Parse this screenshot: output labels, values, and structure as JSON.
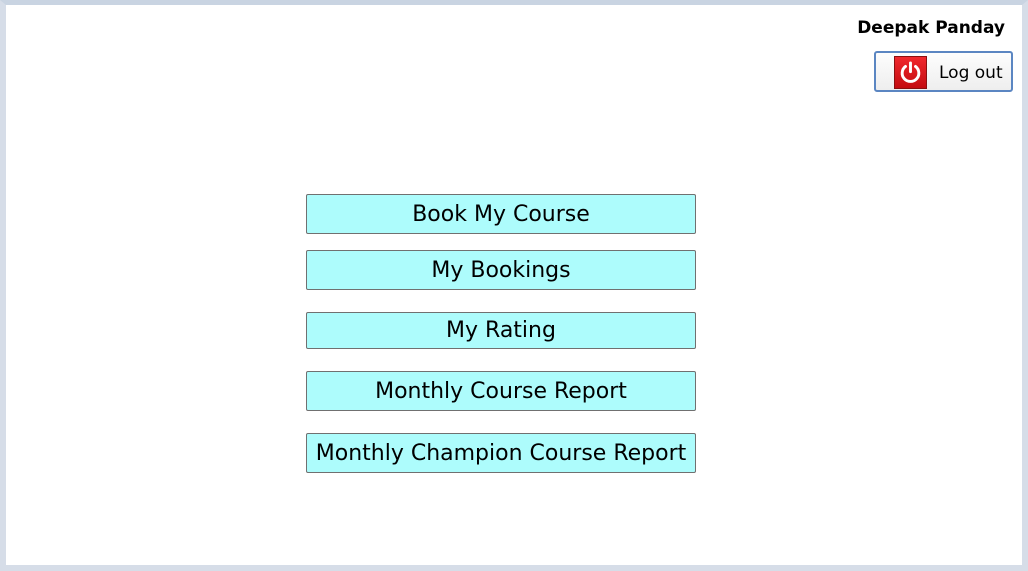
{
  "header": {
    "username": "Deepak Panday",
    "logout_label": "Log out",
    "logout_icon": "power-icon"
  },
  "menu": {
    "items": [
      {
        "label": "Book My Course"
      },
      {
        "label": "My Bookings"
      },
      {
        "label": "My Rating"
      },
      {
        "label": "Monthly Course Report"
      },
      {
        "label": "Monthly Champion Course Report"
      }
    ]
  },
  "colors": {
    "menu_button_bg": "#adfcfc",
    "logout_icon_bg": "#e51c20",
    "logout_border": "#5b86c2"
  }
}
